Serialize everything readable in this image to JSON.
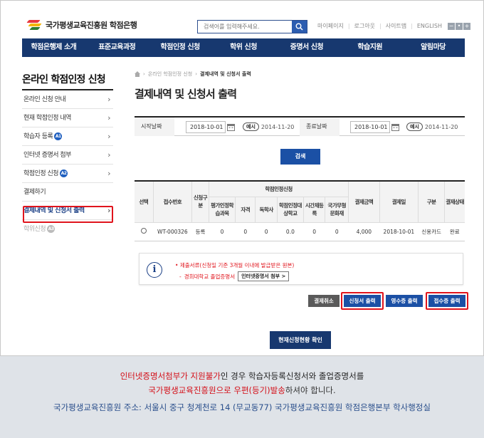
{
  "header": {
    "logo_text": "국가평생교육진흥원 학점은행",
    "search_placeholder": "검색어를 입력해주세요.",
    "links": [
      "마이페이지",
      "로그아웃",
      "사이트맵",
      "ENGLISH"
    ],
    "size_buttons": [
      "−",
      "•",
      "+"
    ]
  },
  "gnb": [
    "학점은행제 소개",
    "표준교육과정",
    "학점인정 신청",
    "학위 신청",
    "증명서 신청",
    "학습지원",
    "알림마당"
  ],
  "lnb": {
    "title": "온라인 학점인정 신청",
    "items": [
      {
        "label": "온라인 신청 안내",
        "badge": ""
      },
      {
        "label": "현재 학점인정 내역",
        "badge": ""
      },
      {
        "label": "학습자 등록",
        "badge": "A1"
      },
      {
        "label": "인터넷 증명서 첨부",
        "badge": ""
      },
      {
        "label": "학점인정 신청",
        "badge": "A2"
      },
      {
        "label": "결제하기",
        "badge": ""
      },
      {
        "label": "결제내역 및 신청서 출력",
        "badge": ""
      },
      {
        "label": "학위신청",
        "badge": "A3"
      }
    ]
  },
  "breadcrumb": [
    "온라인 학점인정 신청",
    "결제내역 및 신청서 출력"
  ],
  "page_title": "결제내역 및 신청서 출력",
  "dates": {
    "start_label": "시작날짜",
    "start_value": "2018-10-01",
    "end_label": "종료날짜",
    "end_value": "2018-10-01",
    "example_tag": "예시",
    "example_value": "2014-11-20"
  },
  "search_button": "검색",
  "table": {
    "group_header": "학점인정신청",
    "headers": {
      "select": "선택",
      "receipt_no": "접수번호",
      "apply_type": "신청구분",
      "sub": [
        "평가인정학습과목",
        "자격",
        "독학사",
        "학점인정대상학교",
        "시간제등록",
        "국가무형문화재"
      ],
      "amount": "결제금액",
      "pay_date": "결제일",
      "kind": "구분",
      "status": "결제상태"
    },
    "rows": [
      {
        "receipt_no": "WT-000326",
        "apply_type": "등록",
        "sub": [
          "0",
          "0",
          "0",
          "0.0",
          "0",
          "0"
        ],
        "amount": "4,000",
        "pay_date": "2018-10-01",
        "kind": "신용카드",
        "status": "완료"
      }
    ]
  },
  "notice": {
    "line1": "제출서류(신청일 기준 3개월 이내에 발급받은 원본)",
    "line2_label": "경희대학교 졸업증명서",
    "line2_button": "인터넷증명서 첨부 >"
  },
  "action_buttons": {
    "cancel": "결제취소",
    "print_application": "신청서 출력",
    "print_receipt": "영수증 출력",
    "print_confirm": "접수증 출력"
  },
  "status_button": "현재신청현황 확인",
  "footer": {
    "l1_red": "인터넷증명서첨부가 지원불가",
    "l1_rest": "인 경우 학습자등록신청서와 졸업증명서를",
    "l2_red": "국가평생교육진흥원으로 우편(등기)발송",
    "l2_rest": "하셔야 합니다.",
    "l3": "국가평생교육진흥원 주소: 서울시 중구 청계천로 14 (무교동77) 국가평생교육진흥원 학점은행본부 학사행정실"
  },
  "colors": {
    "navy": "#17386f",
    "blue": "#1b50a5",
    "highlight": "#e0141c"
  }
}
